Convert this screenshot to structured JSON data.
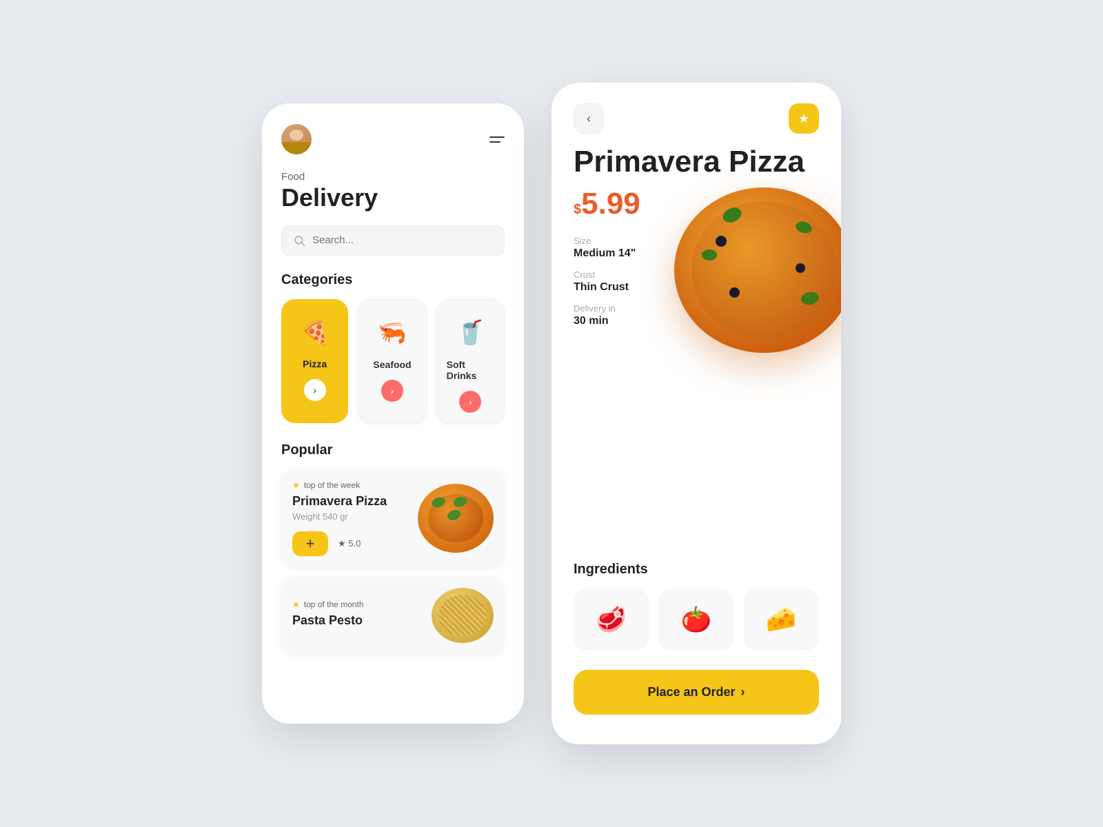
{
  "app": {
    "bg_color": "#e8ecf0"
  },
  "left_screen": {
    "header": {
      "menu_label": "Menu"
    },
    "title": {
      "sub": "Food",
      "main": "Delivery"
    },
    "search": {
      "placeholder": "Search..."
    },
    "categories_title": "Categories",
    "categories": [
      {
        "id": "pizza",
        "label": "Pizza",
        "emoji": "🍕",
        "active": true
      },
      {
        "id": "seafood",
        "label": "Seafood",
        "emoji": "🦐",
        "active": false
      },
      {
        "id": "soft-drinks",
        "label": "Soft Drinks",
        "emoji": "🥤",
        "active": false
      }
    ],
    "popular_title": "Popular",
    "popular_items": [
      {
        "id": "primavera",
        "badge": "top of the week",
        "name": "Primavera Pizza",
        "weight": "Weight 540 gr",
        "rating": "★ 5.0"
      },
      {
        "id": "pasta",
        "badge": "top of the month",
        "name": "Pasta Pesto",
        "weight": "",
        "rating": ""
      }
    ]
  },
  "right_screen": {
    "title": "Primavera Pizza",
    "price_symbol": "$",
    "price": "5.99",
    "price_color": "#e85d2a",
    "specs": [
      {
        "label": "Size",
        "value": "Medium 14\""
      },
      {
        "label": "Crust",
        "value": "Thin Crust"
      },
      {
        "label": "Delivery in",
        "value": "30 min"
      }
    ],
    "ingredients_title": "Ingredients",
    "ingredients": [
      {
        "id": "ham",
        "emoji": "🥩"
      },
      {
        "id": "tomato",
        "emoji": "🍅"
      },
      {
        "id": "cheese",
        "emoji": "🧀"
      }
    ],
    "order_button": "Place an Order",
    "order_arrow": "›",
    "back_icon": "‹",
    "fav_icon": "★"
  }
}
